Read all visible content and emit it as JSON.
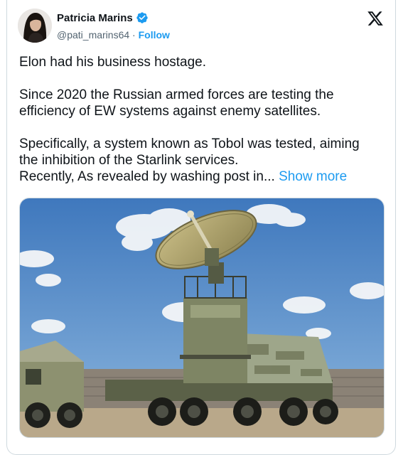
{
  "author": {
    "name": "Patricia Marins",
    "handle": "@pati_marins64",
    "separator": "·",
    "follow_label": "Follow",
    "verified_icon": "verified-badge-icon"
  },
  "platform_icon": "x-logo-icon",
  "tweet": {
    "paragraphs": [
      "Elon had his business hostage.",
      "Since 2020 the Russian armed forces are testing the efficiency of EW systems against enemy satellites.",
      "Specifically, a system known as Tobol was tested, aiming the inhibition of the Starlink services."
    ],
    "last_line": "Recently, As revealed by washing post in...",
    "show_more": "Show more"
  },
  "media": {
    "kind": "photo",
    "subject": "radar-dish-military-truck"
  },
  "colors": {
    "accent": "#1d9bf0",
    "text": "#0f1419",
    "muted": "#536471"
  }
}
